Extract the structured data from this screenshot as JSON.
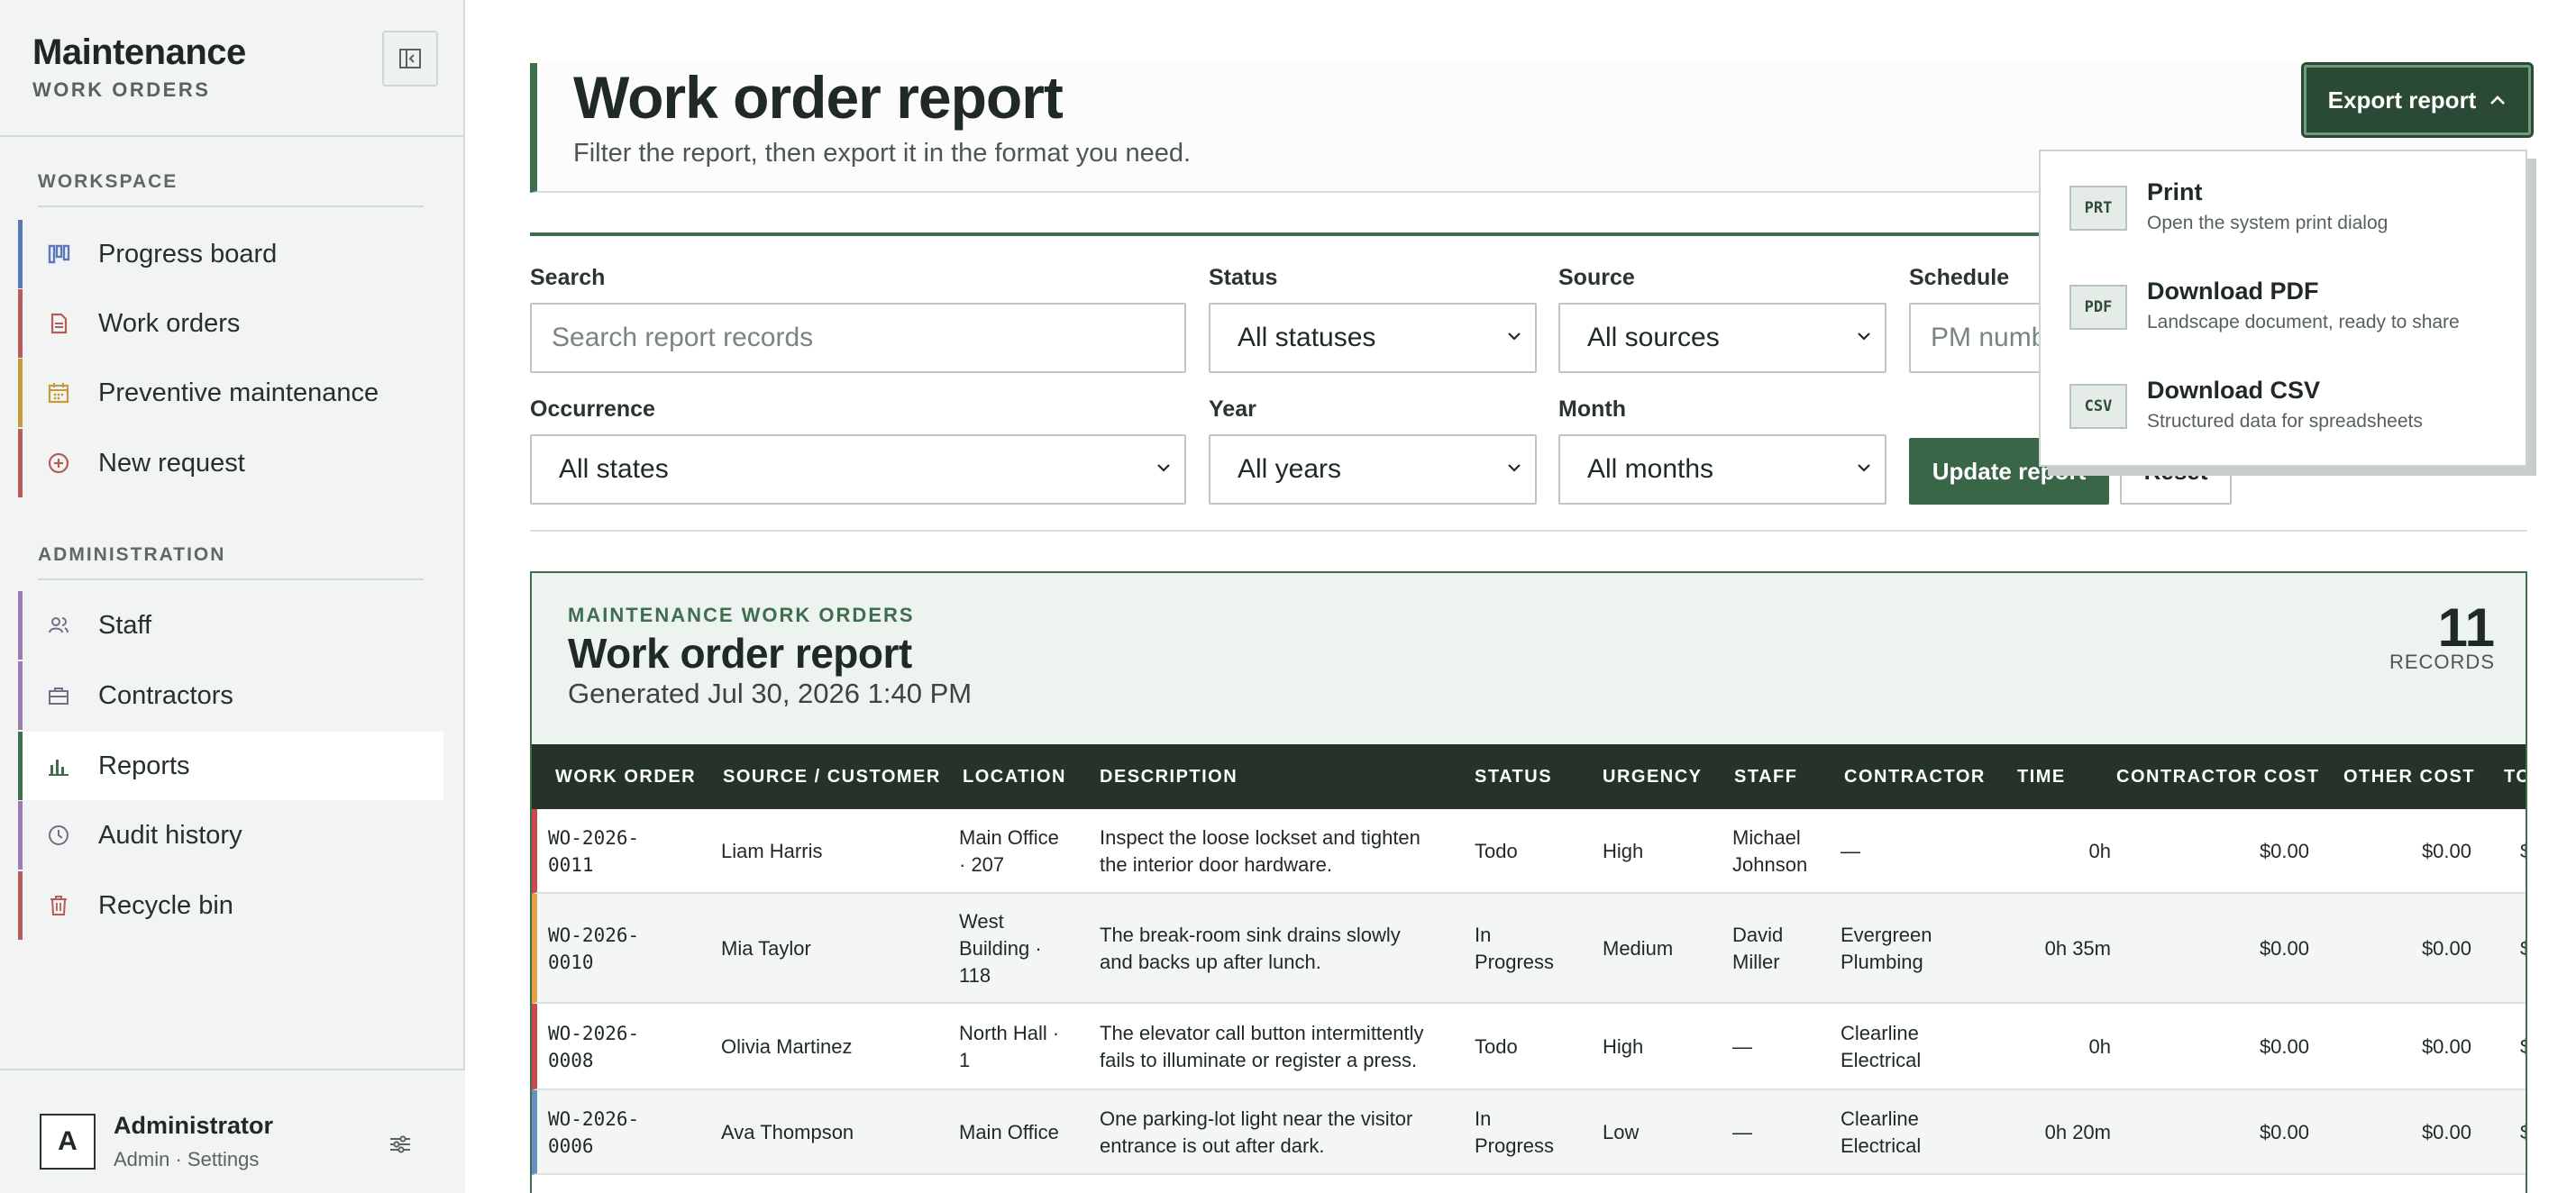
{
  "sidebar": {
    "brand_title": "Maintenance",
    "brand_sub": "WORK ORDERS",
    "workspace_label": "WORKSPACE",
    "admin_label": "ADMINISTRATION",
    "workspace_items": [
      {
        "label": "Progress board",
        "icon": "kanban-icon",
        "color": "#5b78b8"
      },
      {
        "label": "Work orders",
        "icon": "document-icon",
        "color": "#b85b5b"
      },
      {
        "label": "Preventive maintenance",
        "icon": "calendar-icon",
        "color": "#c89a3e"
      },
      {
        "label": "New request",
        "icon": "plus-circle-icon",
        "color": "#b85b5b"
      }
    ],
    "admin_items": [
      {
        "label": "Staff",
        "icon": "users-icon",
        "color": "#9b7bb0"
      },
      {
        "label": "Contractors",
        "icon": "briefcase-icon",
        "color": "#9b7bb0"
      },
      {
        "label": "Reports",
        "icon": "bar-chart-icon",
        "color": "#3f6e4e"
      },
      {
        "label": "Audit history",
        "icon": "clock-icon",
        "color": "#9b7bb0"
      },
      {
        "label": "Recycle bin",
        "icon": "trash-icon",
        "color": "#b85b5b"
      }
    ],
    "user": {
      "initial": "A",
      "name": "Administrator",
      "sub": "Admin · Settings"
    }
  },
  "header": {
    "title": "Work order report",
    "subtitle": "Filter the report, then export it in the format you need.",
    "export_label": "Export report"
  },
  "filters": {
    "search_label": "Search",
    "search_placeholder": "Search report records",
    "status_label": "Status",
    "status_value": "All statuses",
    "source_label": "Source",
    "source_value": "All sources",
    "schedule_label": "Schedule",
    "schedule_placeholder": "PM numb",
    "occurrence_label": "Occurrence",
    "occurrence_value": "All states",
    "year_label": "Year",
    "year_value": "All years",
    "month_label": "Month",
    "month_value": "All months",
    "update_label": "Update report",
    "reset_label": "Reset"
  },
  "export_menu": [
    {
      "badge": "PRT",
      "title": "Print",
      "desc": "Open the system print dialog"
    },
    {
      "badge": "PDF",
      "title": "Download PDF",
      "desc": "Landscape document, ready to share"
    },
    {
      "badge": "CSV",
      "title": "Download CSV",
      "desc": "Structured data for spreadsheets"
    }
  ],
  "report": {
    "eyebrow": "MAINTENANCE WORK ORDERS",
    "title": "Work order report",
    "generated": "Generated Jul 30, 2026 1:40 PM",
    "count": "11",
    "count_label": "RECORDS",
    "columns": [
      "WORK ORDER",
      "SOURCE / CUSTOMER",
      "LOCATION",
      "DESCRIPTION",
      "STATUS",
      "URGENCY",
      "STAFF",
      "CONTRACTOR",
      "TIME",
      "CONTRACTOR COST",
      "OTHER COST",
      "TO"
    ],
    "rows": [
      {
        "wo": "WO-2026-\n0011",
        "source": "Liam Harris",
        "location": "Main Office\n· 207",
        "description": "Inspect the loose lockset and tighten\nthe interior door hardware.",
        "status": "Todo",
        "urgency": "High",
        "staff": "Michael\nJohnson",
        "contractor": "—",
        "time": "0h",
        "ccost": "$0.00",
        "ocost": "$0.00",
        "total": "$",
        "accent": "#c84a4a"
      },
      {
        "wo": "WO-2026-\n0010",
        "source": "Mia Taylor",
        "location": "West\nBuilding ·\n118",
        "description": "The break-room sink drains slowly\nand backs up after lunch.",
        "status": "In\nProgress",
        "urgency": "Medium",
        "staff": "David\nMiller",
        "contractor": "Evergreen\nPlumbing",
        "time": "0h 35m",
        "ccost": "$0.00",
        "ocost": "$0.00",
        "total": "$",
        "accent": "#e0a340"
      },
      {
        "wo": "WO-2026-\n0008",
        "source": "Olivia Martinez",
        "location": "North Hall ·\n1",
        "description": "The elevator call button intermittently\nfails to illuminate or register a press.",
        "status": "Todo",
        "urgency": "High",
        "staff": "—",
        "contractor": "Clearline\nElectrical",
        "time": "0h",
        "ccost": "$0.00",
        "ocost": "$0.00",
        "total": "$",
        "accent": "#c84a4a"
      },
      {
        "wo": "WO-2026-\n0006",
        "source": "Ava Thompson",
        "location": "Main Office",
        "description": "One parking-lot light near the visitor\nentrance is out after dark.",
        "status": "In\nProgress",
        "urgency": "Low",
        "staff": "—",
        "contractor": "Clearline\nElectrical",
        "time": "0h 20m",
        "ccost": "$0.00",
        "ocost": "$0.00",
        "total": "$",
        "accent": "#6b8fc0"
      }
    ]
  }
}
